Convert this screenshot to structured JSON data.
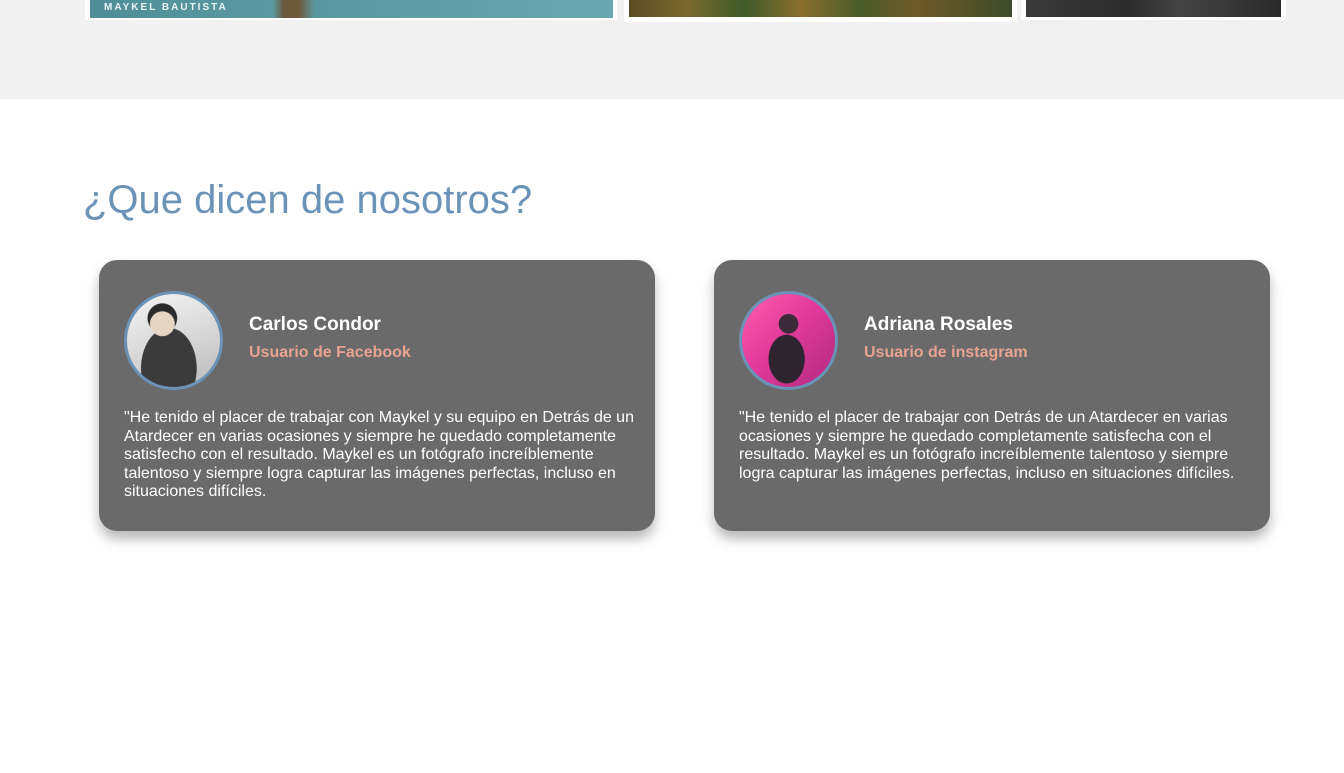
{
  "gallery": {
    "photo_caption": "MAYKEL BAUTISTA"
  },
  "testimonials": {
    "title": "¿Que dicen de nosotros?",
    "items": [
      {
        "name": "Carlos Condor",
        "source": "Usuario de Facebook",
        "quote": "\"He tenido el placer de trabajar con Maykel y su equipo en Detrás de un Atardecer en varias ocasiones y siempre he quedado completamente satisfecho con el resultado. Maykel es un fotógrafo increíblemente talentoso y siempre logra capturar las imágenes perfectas, incluso en situaciones difíciles."
      },
      {
        "name": "Adriana Rosales",
        "source": "Usuario de instagram",
        "quote": "\"He tenido el placer de trabajar con Detrás de un Atardecer en varias ocasiones y siempre he quedado completamente satisfecha con el resultado. Maykel es un fotógrafo increíblemente talentoso y siempre logra capturar las imágenes perfectas, incluso en situaciones difíciles."
      }
    ]
  },
  "colors": {
    "title": "#6b93b8",
    "card_bg": "#6a6a6a",
    "source_text": "#e9a38f",
    "strip_bg": "#f1f1f1"
  }
}
